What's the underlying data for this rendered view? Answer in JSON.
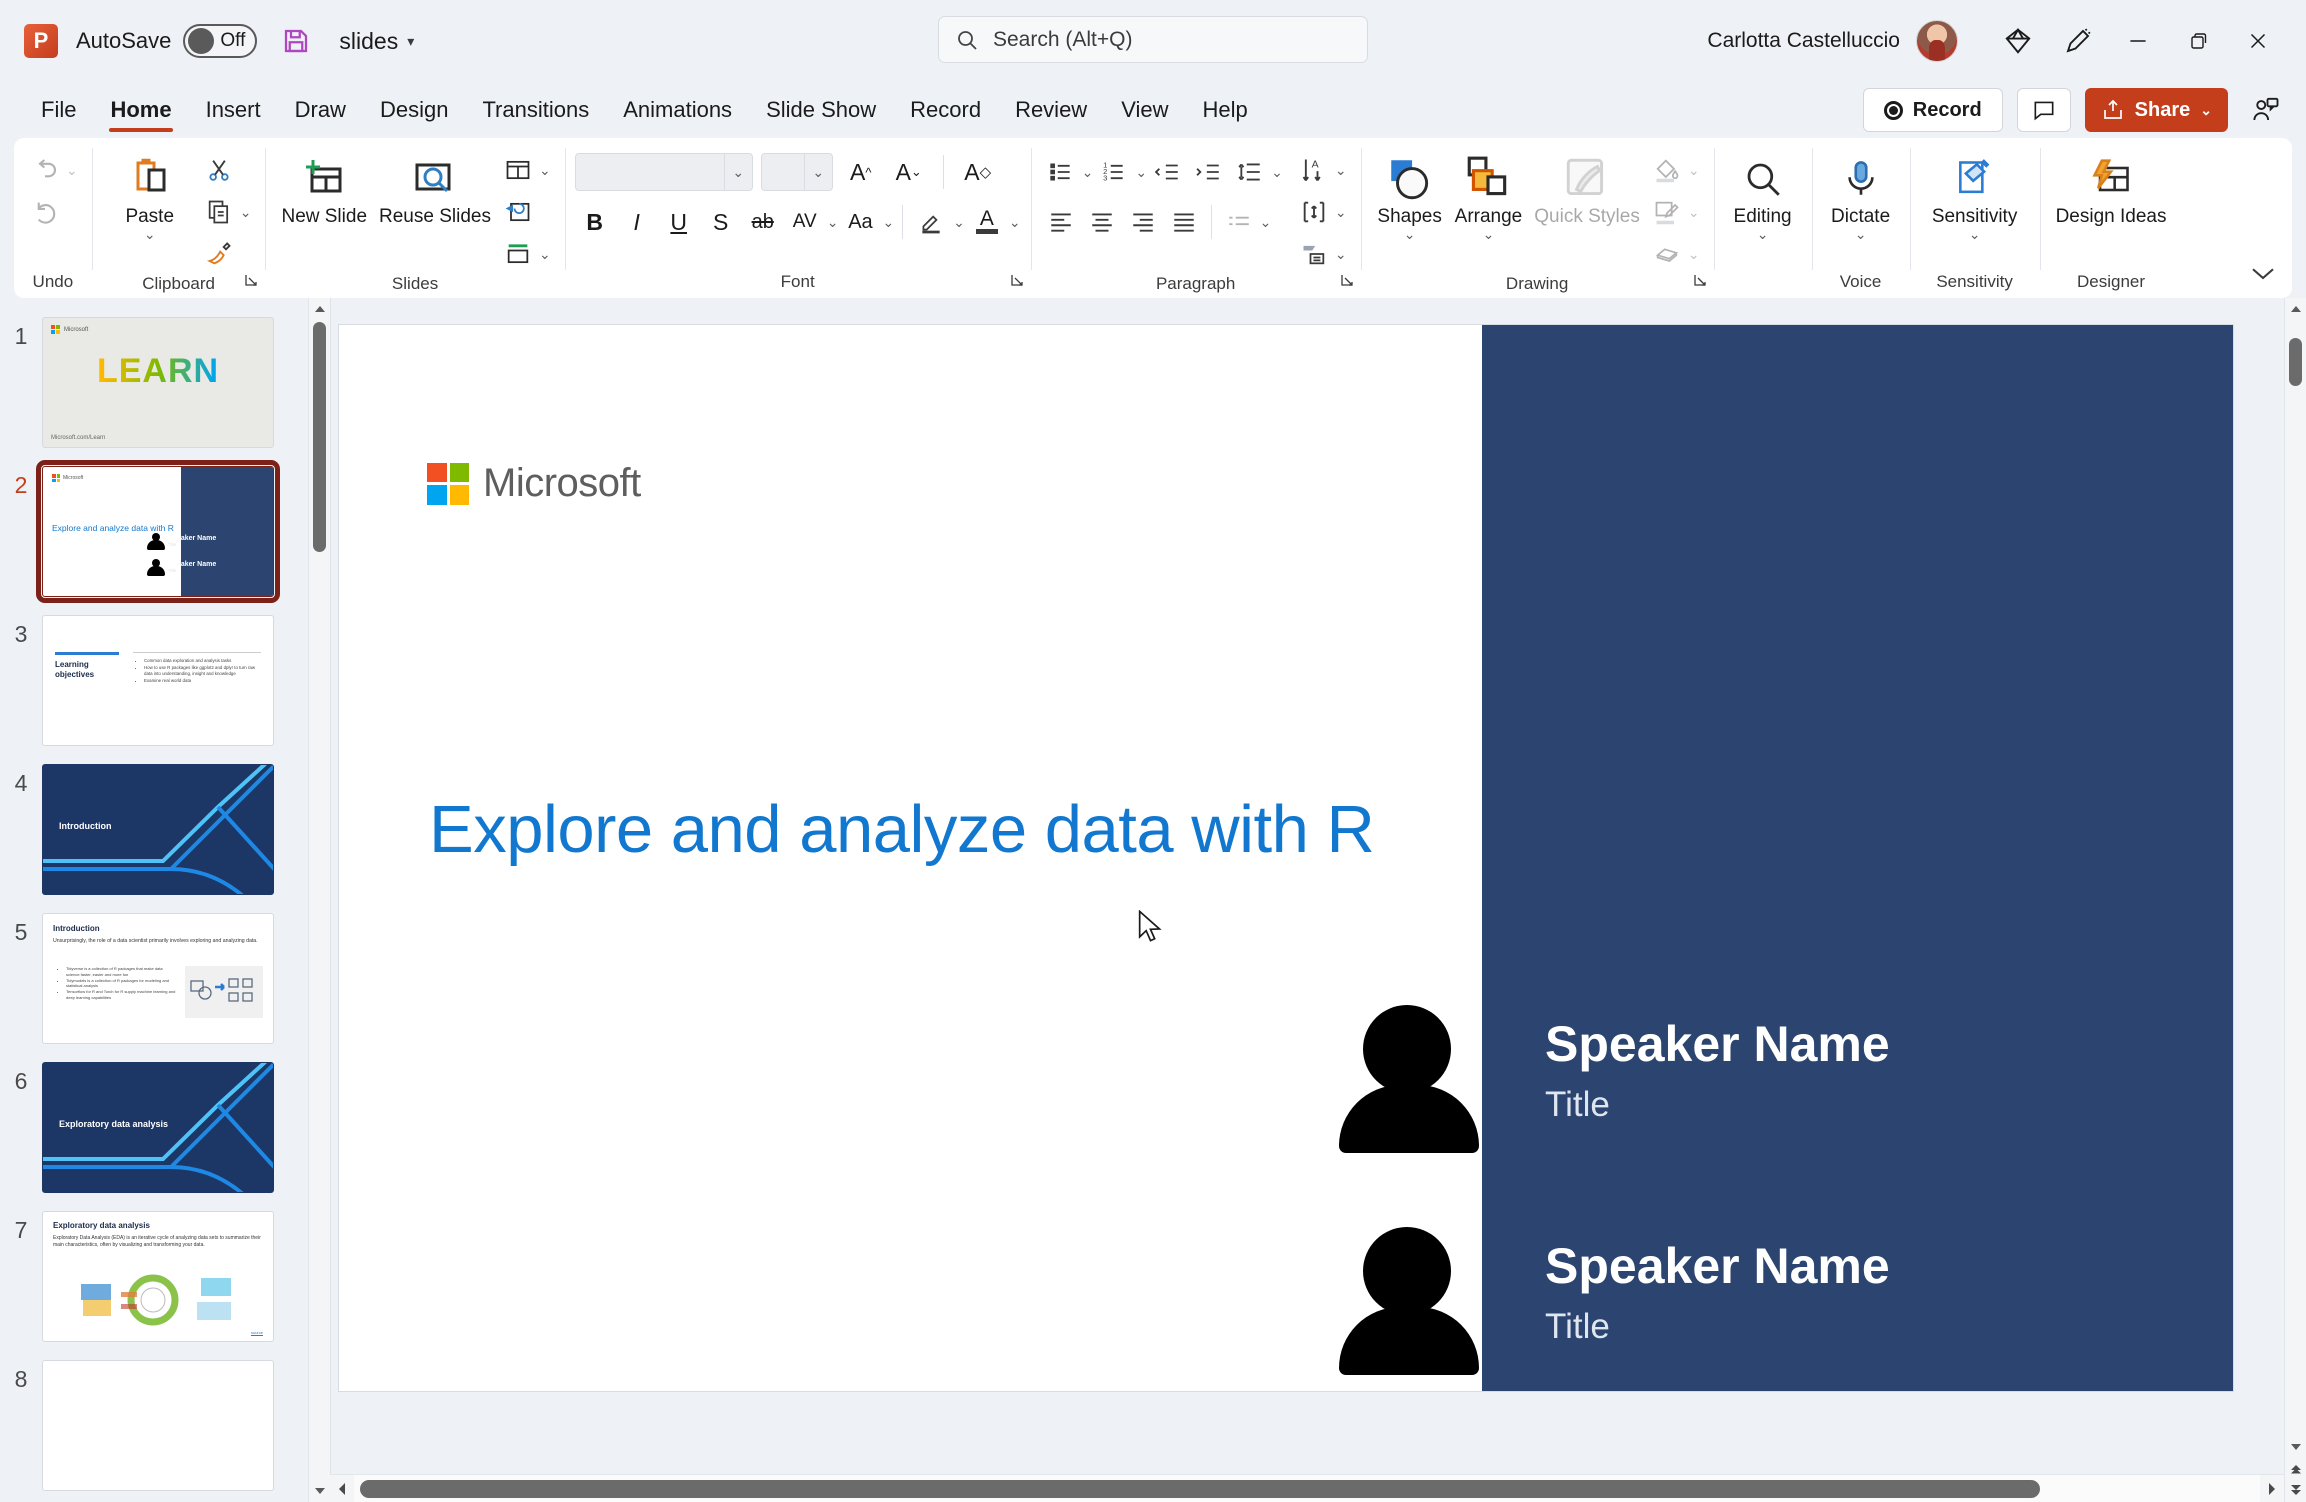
{
  "titlebar": {
    "app_icon": "powerpoint-icon",
    "autosave_label": "AutoSave",
    "autosave_state": "Off",
    "save_icon": "save-icon",
    "document_name": "slides",
    "document_caret": "▾",
    "search_placeholder": "Search (Alt+Q)",
    "search_icon": "search-icon",
    "user_name": "Carlotta Castelluccio",
    "avatar": "user-avatar",
    "diamond_icon": "diamond-icon",
    "pen_icon": "ink-pen-icon",
    "minimize": "─",
    "restore": "❐",
    "close": "✕"
  },
  "tabs": [
    {
      "label": "File",
      "active": false
    },
    {
      "label": "Home",
      "active": true
    },
    {
      "label": "Insert",
      "active": false
    },
    {
      "label": "Draw",
      "active": false
    },
    {
      "label": "Design",
      "active": false
    },
    {
      "label": "Transitions",
      "active": false
    },
    {
      "label": "Animations",
      "active": false
    },
    {
      "label": "Slide Show",
      "active": false
    },
    {
      "label": "Record",
      "active": false
    },
    {
      "label": "Review",
      "active": false
    },
    {
      "label": "View",
      "active": false
    },
    {
      "label": "Help",
      "active": false
    }
  ],
  "tabs_right": {
    "record_label": "Record",
    "comments_icon": "comment-icon",
    "share_label": "Share",
    "share_caret": "⌄",
    "share_person_icon": "share-person-icon",
    "share_color": "#c43e1c"
  },
  "ribbon": {
    "groups": [
      {
        "name": "Undo",
        "label": "Undo",
        "items": [
          {
            "name": "undo-button",
            "icon": "undo-arrow-icon",
            "caret": true,
            "disabled": true
          },
          {
            "name": "redo-button",
            "icon": "redo-arrow-icon",
            "caret": false,
            "disabled": true
          }
        ]
      },
      {
        "name": "Clipboard",
        "label": "Clipboard",
        "paste_label": "Paste",
        "items": [
          {
            "name": "cut-button",
            "icon": "scissors-icon"
          },
          {
            "name": "copy-button",
            "icon": "copy-icon"
          },
          {
            "name": "format-painter-button",
            "icon": "format-painter-icon"
          }
        ],
        "has_launcher": true
      },
      {
        "name": "Slides",
        "label": "Slides",
        "new_slide_label": "New Slide",
        "reuse_slides_label": "Reuse Slides",
        "items": [
          {
            "name": "layout-button",
            "icon": "layout-icon"
          },
          {
            "name": "reset-button",
            "icon": "reset-slide-icon"
          },
          {
            "name": "section-button",
            "icon": "section-icon"
          }
        ]
      },
      {
        "name": "Font",
        "label": "Font",
        "font_name_value": "",
        "font_size_value": "",
        "buttons": [
          {
            "name": "bold-button",
            "glyph": "B"
          },
          {
            "name": "italic-button",
            "glyph": "I"
          },
          {
            "name": "underline-button",
            "glyph": "U"
          },
          {
            "name": "shadow-button",
            "glyph": "S"
          },
          {
            "name": "strikethrough-button",
            "glyph": "ab"
          },
          {
            "name": "character-spacing-button",
            "glyph": "AV"
          },
          {
            "name": "change-case-button",
            "glyph": "Aa"
          },
          {
            "name": "text-highlight-color-button",
            "glyph": "highlighter"
          },
          {
            "name": "font-color-button",
            "glyph": "A"
          }
        ],
        "grow_shrink": [
          "increase-font-size-button",
          "decrease-font-size-button",
          "clear-formatting-button"
        ],
        "has_launcher": true
      },
      {
        "name": "Paragraph",
        "label": "Paragraph",
        "row1": [
          "bullets-button",
          "numbering-button",
          "decrease-indent-button",
          "increase-indent-button",
          "line-spacing-button"
        ],
        "row2": [
          "align-left-button",
          "align-center-button",
          "align-right-button",
          "justify-button",
          "columns-button"
        ],
        "side": [
          "text-direction-button",
          "align-text-button",
          "convert-to-smartart-button"
        ],
        "has_launcher": true
      },
      {
        "name": "Drawing",
        "label": "Drawing",
        "shapes_label": "Shapes",
        "arrange_label": "Arrange",
        "quick_styles_label": "Quick Styles",
        "side": [
          "shape-fill-button",
          "shape-outline-button",
          "shape-effects-button"
        ],
        "has_launcher": true
      },
      {
        "name": "Editing",
        "label": "",
        "editing_label": "Editing"
      },
      {
        "name": "Voice",
        "label": "Voice",
        "dictate_label": "Dictate"
      },
      {
        "name": "Sensitivity",
        "label": "Sensitivity",
        "sensitivity_label": "Sensitivity"
      },
      {
        "name": "Designer",
        "label": "Designer",
        "design_ideas_label": "Design Ideas"
      }
    ],
    "collapse_icon": "chevron-down-icon"
  },
  "thumbnails": [
    {
      "number": "1",
      "selected": false,
      "kind": "learn",
      "title": "LEARN",
      "footer": "Microsoft.com/Learn"
    },
    {
      "number": "2",
      "selected": true,
      "kind": "title-speaker",
      "title": "Explore and analyze data with R",
      "speaker": "Speaker Name",
      "speaker_title": "Title"
    },
    {
      "number": "3",
      "selected": false,
      "kind": "objectives",
      "title": "Learning objectives",
      "bullets": [
        "Common data exploration and analysis tasks",
        "How to use R packages like ggplot2 and dplyr to turn raw data into understanding, insight and knowledge",
        "Examine real world data"
      ]
    },
    {
      "number": "4",
      "selected": false,
      "kind": "section",
      "title": "Introduction"
    },
    {
      "number": "5",
      "selected": false,
      "kind": "content",
      "title": "Introduction",
      "body": "Unsurprisingly, the role of a data scientist primarily involves exploring and analyzing data.",
      "bullets": [
        "Tidyverse is a collection of R packages that make data science faster, easier and more fun",
        "Tidymodels is a collection of R packages for modeling and statistical analysis",
        "Tensorflow for R and Torch for R supply machine learning and deep learning capabilities"
      ]
    },
    {
      "number": "6",
      "selected": false,
      "kind": "section",
      "title": "Exploratory data analysis"
    },
    {
      "number": "7",
      "selected": false,
      "kind": "content",
      "title": "Exploratory data analysis",
      "body": "Exploratory Data Analysis (EDA) is an iterative cycle of analyzing data sets to summarize their main characteristics, often by visualizing and transforming your data."
    },
    {
      "number": "8",
      "selected": false,
      "kind": "content",
      "title": ""
    }
  ],
  "slide": {
    "brand": "Microsoft",
    "brand_logo": "microsoft-logo-icon",
    "title": "Explore and analyze data with R",
    "title_color": "#1278cf",
    "panel_color": "#2b4570",
    "speakers": [
      {
        "name": "Speaker Name",
        "title": "Title",
        "icon": "person-silhouette-icon"
      },
      {
        "name": "Speaker Name",
        "title": "Title",
        "icon": "person-silhouette-icon"
      }
    ],
    "cursor_icon": "mouse-pointer-icon"
  },
  "scrollbars": {
    "thumbnail_up": "▲",
    "thumbnail_down": "▼",
    "canvas_up": "▲",
    "canvas_down": "▼",
    "prev_slide": "▲",
    "next_slide": "▼",
    "left_arrow": "◀",
    "right_arrow": "▶"
  }
}
